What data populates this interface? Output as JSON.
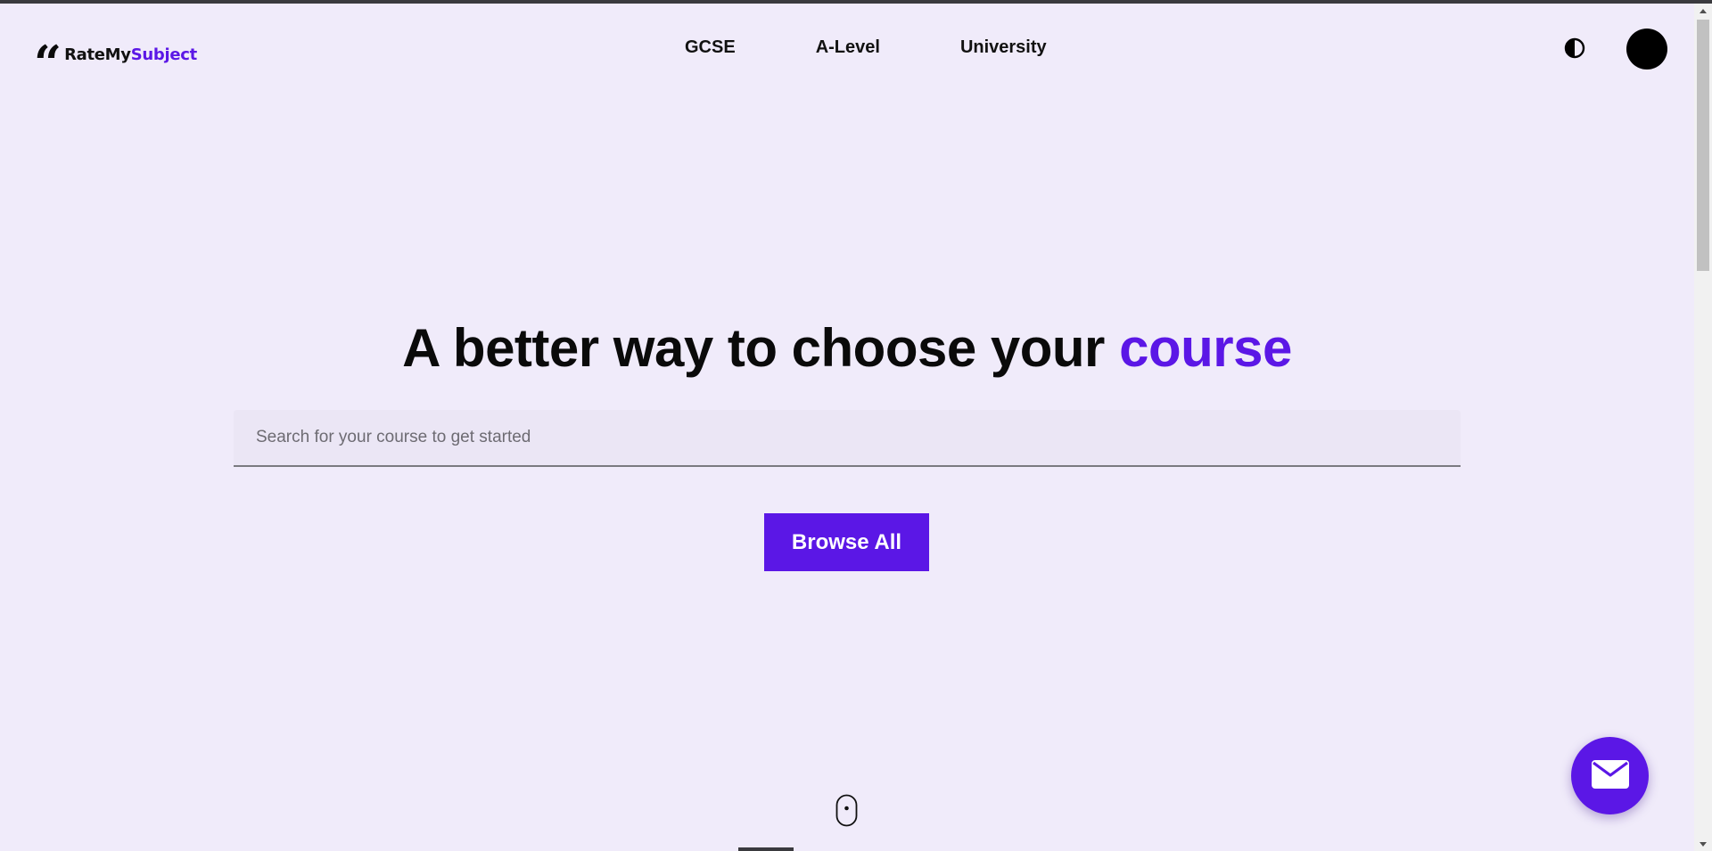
{
  "brand": {
    "name_part1": "RateMy",
    "name_part2": "Subject",
    "mark_icon": "quote-icon",
    "accent_color": "#5b17e6"
  },
  "nav": {
    "items": [
      {
        "label": "GCSE"
      },
      {
        "label": "A-Level"
      },
      {
        "label": "University"
      }
    ]
  },
  "header_actions": {
    "theme_icon": "contrast-icon",
    "avatar_icon": "avatar"
  },
  "hero": {
    "title_main": "A better way to choose your",
    "title_accent": "course"
  },
  "search": {
    "placeholder": "Search for your course to get started",
    "value": ""
  },
  "browse_button": {
    "label": "Browse All"
  },
  "scroll_indicator": {
    "icon": "mouse-scroll-icon"
  },
  "contact_fab": {
    "icon": "envelope-icon"
  },
  "colors": {
    "background": "#f0ebfa",
    "accent": "#5b17e6",
    "text": "#0a0a0a"
  }
}
